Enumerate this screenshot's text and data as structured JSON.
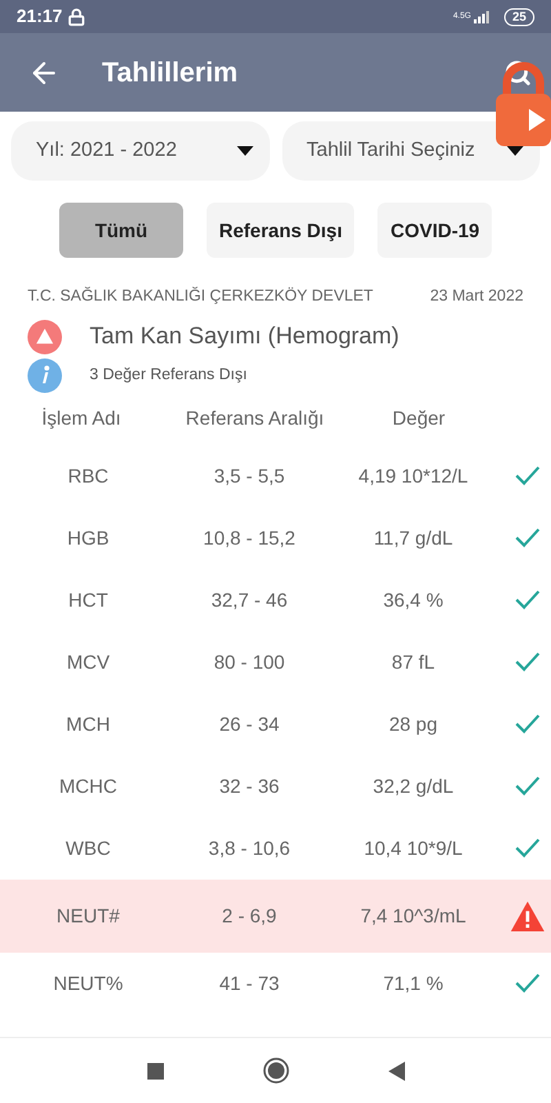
{
  "status_bar": {
    "time": "21:17",
    "network": "4.5G",
    "battery": "25"
  },
  "header": {
    "title": "Tahlillerim"
  },
  "filters": [
    {
      "label": "Yıl: 2021 - 2022"
    },
    {
      "label": "Tahlil Tarihi Seçiniz"
    }
  ],
  "chips": [
    {
      "label": "Tümü",
      "selected": true
    },
    {
      "label": "Referans Dışı",
      "selected": false
    },
    {
      "label": "COVID-19",
      "selected": false
    }
  ],
  "report": {
    "hospital": "T.C. SAĞLIK BAKANLIĞI ÇERKEZKÖY DEVLET",
    "date": "23 Mart 2022",
    "test_name": "Tam Kan Sayımı (Hemogram)",
    "note": "3 Değer Referans Dışı"
  },
  "table": {
    "columns": [
      "İşlem Adı",
      "Referans Aralığı",
      "Değer"
    ],
    "rows": [
      {
        "name": "RBC",
        "range": "3,5 - 5,5",
        "value": "4,19 10*12/L",
        "out_of_range": false
      },
      {
        "name": "HGB",
        "range": "10,8 - 15,2",
        "value": "11,7 g/dL",
        "out_of_range": false
      },
      {
        "name": "HCT",
        "range": "32,7 - 46",
        "value": "36,4 %",
        "out_of_range": false
      },
      {
        "name": "MCV",
        "range": "80 - 100",
        "value": "87 fL",
        "out_of_range": false
      },
      {
        "name": "MCH",
        "range": "26 - 34",
        "value": "28 pg",
        "out_of_range": false
      },
      {
        "name": "MCHC",
        "range": "32 - 36",
        "value": "32,2 g/dL",
        "out_of_range": false
      },
      {
        "name": "WBC",
        "range": "3,8 - 10,6",
        "value": "10,4 10*9/L",
        "out_of_range": false
      },
      {
        "name": "NEUT#",
        "range": "2 - 6,9",
        "value": "7,4 10^3/mL",
        "out_of_range": true
      },
      {
        "name": "NEUT%",
        "range": "41 - 73",
        "value": "71,1 %",
        "out_of_range": false
      }
    ]
  }
}
